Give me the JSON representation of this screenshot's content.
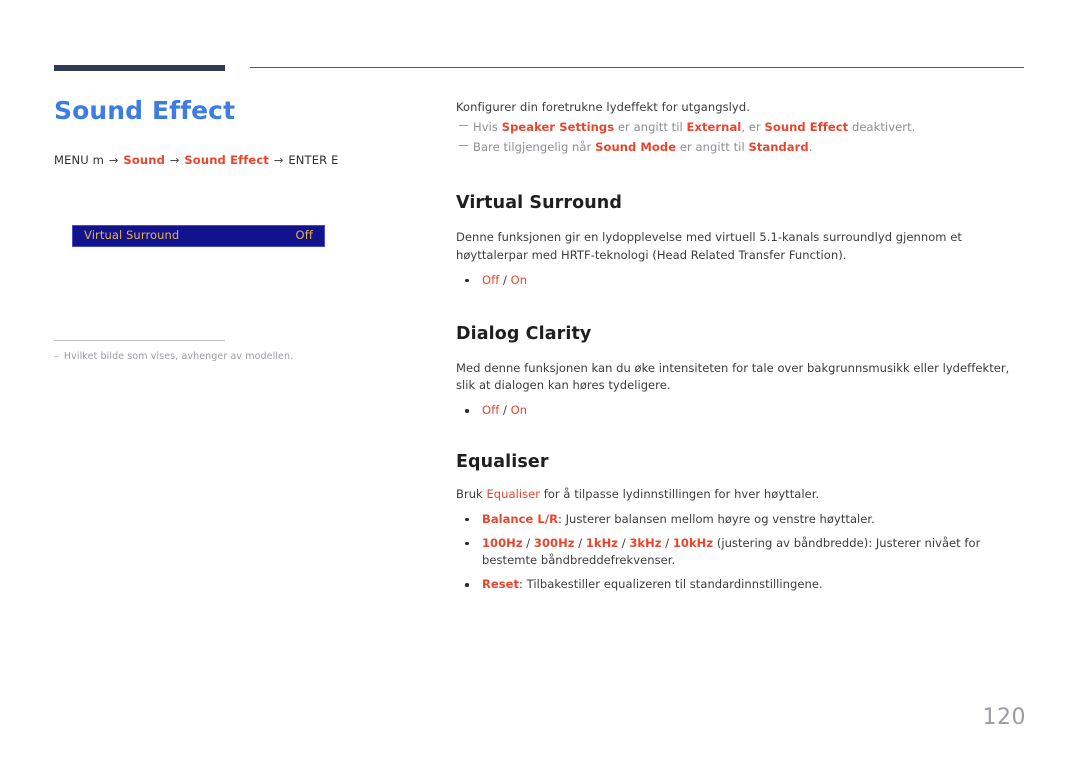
{
  "header": {
    "thick_rule": "navy-accent-bar",
    "thin_rule": "header-divider"
  },
  "left": {
    "page_title": "Sound Effect",
    "menu_path": {
      "prefix": "MENU",
      "prefix_key": "m",
      "arrow": "→",
      "step1": "Sound",
      "step2": "Sound Effect",
      "suffix": "ENTER",
      "suffix_key": "E"
    },
    "osd": {
      "label": "Virtual Surround",
      "value": "Off"
    },
    "footnote": {
      "dash": "–",
      "text": "Hvilket bilde som vises, avhenger av modellen."
    }
  },
  "right": {
    "intro": "Konfigurer din foretrukne lydeffekt for utgangslyd.",
    "notes": [
      {
        "pre": "Hvis ",
        "hl1": "Speaker Settings",
        "mid1": " er angitt til ",
        "hl2": "External",
        "mid2": ", er ",
        "hl3": "Sound Effect",
        "post": " deaktivert."
      },
      {
        "pre": "Bare tilgjengelig når ",
        "hl1": "Sound Mode",
        "mid1": " er angitt til ",
        "hl2": "Standard",
        "mid2": ".",
        "hl3": "",
        "post": ""
      }
    ],
    "sections": [
      {
        "title": "Virtual Surround",
        "body": "Denne funksjonen gir en lydopplevelse med virtuell 5.1-kanals surroundlyd gjennom et høyttalerpar med HRTF-teknologi (Head Related Transfer Function).",
        "options": {
          "off": "Off",
          "sep": " / ",
          "on": "On"
        }
      },
      {
        "title": "Dialog Clarity",
        "body": "Med denne funksjonen kan du øke intensiteten for tale over bakgrunnsmusikk eller lydeffekter, slik at dialogen kan høres tydeligere.",
        "options": {
          "off": "Off",
          "sep": " / ",
          "on": "On"
        }
      },
      {
        "title": "Equaliser",
        "body_pre": "Bruk ",
        "body_hl": "Equaliser",
        "body_post": " for å tilpasse lydinnstillingen for hver høyttaler.",
        "bullets": [
          {
            "hl": "Balance L/R",
            "text": ": Justerer balansen mellom høyre og venstre høyttaler."
          },
          {
            "freqs": [
              "100Hz",
              "300Hz",
              "1kHz",
              "3kHz",
              "10kHz"
            ],
            "sep": " / ",
            "text": " (justering av båndbredde): Justerer nivået for bestemte båndbreddefrekvenser."
          },
          {
            "hl": "Reset",
            "text": ": Tilbakestiller equalizeren til standardinnstillingene."
          }
        ]
      }
    ]
  },
  "footer": {
    "page_number": "120"
  },
  "colors": {
    "accent_blue": "#3d7ce0",
    "highlight_red": "#e8452c",
    "navy_bar": "#2e3b55",
    "osd_bg": "#12128e",
    "osd_text": "#e0b44a",
    "page_num": "#9c9ca4"
  }
}
